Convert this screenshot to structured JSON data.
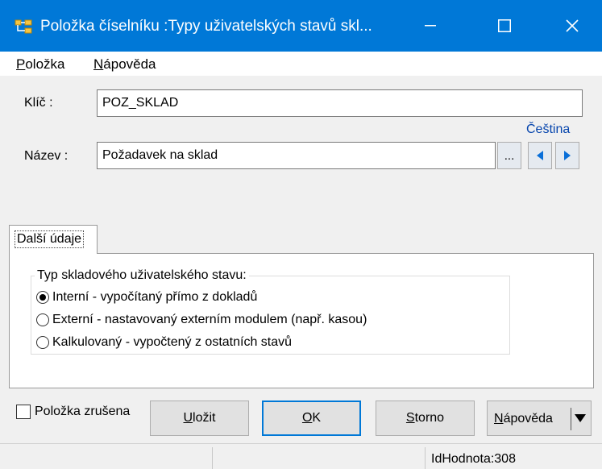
{
  "window": {
    "title": "Položka  číselníku :Typy uživatelských stavů skl...",
    "icon": "app-tree-icon"
  },
  "menu": {
    "items": [
      {
        "accel": "P",
        "rest": "oložka"
      },
      {
        "accel": "N",
        "rest": "ápověda"
      }
    ]
  },
  "form": {
    "key_label": "Klíč :",
    "key_value": "POZ_SKLAD",
    "name_label": "Název :",
    "name_value": "Požadavek na sklad",
    "language": "Čeština",
    "ellipsis": "..."
  },
  "tabs": [
    {
      "label": "Další údaje"
    }
  ],
  "group": {
    "title": "Typ skladového uživatelského stavu:",
    "options": [
      {
        "label": "Interní - vypočítaný přímo z dokladů",
        "checked": true
      },
      {
        "label": "Externí - nastavovaný externím modulem (např. kasou)",
        "checked": false
      },
      {
        "label": "Kalkulovaný - vypočtený z ostatních stavů",
        "checked": false
      }
    ]
  },
  "footer": {
    "cancelled_label": "Položka zrušena",
    "save": {
      "accel": "U",
      "rest": "ložit"
    },
    "ok": {
      "accel": "O",
      "rest": "K"
    },
    "cancel": {
      "accel": "S",
      "rest": "torno"
    },
    "help": {
      "accel": "N",
      "rest": "ápověda"
    }
  },
  "status": {
    "text": "IdHodnota:308"
  },
  "colors": {
    "titlebar": "#0078d7",
    "accent": "#0078d7",
    "link": "#0645ad"
  }
}
